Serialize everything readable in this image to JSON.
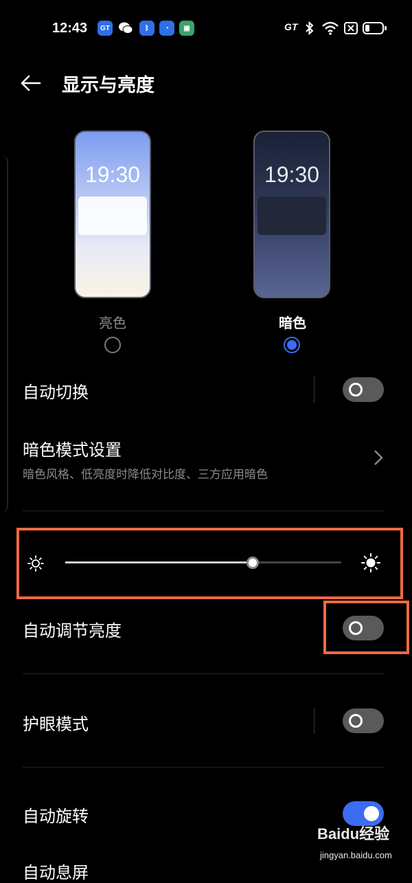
{
  "status_bar": {
    "time": "12:43",
    "app_icons": [
      {
        "icon": "gt-app-icon",
        "text": "GT",
        "color": "#2f6fe8"
      },
      {
        "icon": "wechat-icon",
        "text": "",
        "color": "#000000"
      },
      {
        "icon": "bluetooth-app-icon",
        "text": "",
        "color": "#2f6fe8"
      },
      {
        "icon": "chat-app-icon",
        "text": "",
        "color": "#2f6fe8"
      },
      {
        "icon": "wallet-app-icon",
        "text": "",
        "color": "#3aa36d"
      }
    ],
    "mode_text": "GT",
    "right_icons": [
      "bluetooth-icon",
      "wifi-icon",
      "sim-icon",
      "battery-icon"
    ]
  },
  "header": {
    "title": "显示与亮度",
    "back_icon": "back-arrow-icon"
  },
  "theme": {
    "light": {
      "preview_time": "19:30",
      "label": "亮色",
      "selected": false
    },
    "dark": {
      "preview_time": "19:30",
      "label": "暗色",
      "selected": true
    }
  },
  "rows": {
    "auto_switch": {
      "label": "自动切换",
      "on": false
    },
    "dark_mode_settings": {
      "label": "暗色模式设置",
      "sub": "暗色风格、低亮度时降低对比度、三方应用暗色"
    },
    "auto_brightness": {
      "label": "自动调节亮度",
      "on": false
    },
    "eye_comfort": {
      "label": "护眼模式",
      "on": false
    },
    "auto_rotate": {
      "label": "自动旋转",
      "on": true
    },
    "auto_screen_off": {
      "label": "自动息屏"
    }
  },
  "brightness": {
    "level_percent": 68,
    "low_icon": "sun-low-icon",
    "high_icon": "sun-high-icon"
  },
  "watermark": {
    "text": "Baidu经验",
    "url": "jingyan.baidu.com"
  },
  "colors": {
    "accent": "#3b6cf2",
    "highlight": "#ed6a43",
    "background": "#000000"
  }
}
